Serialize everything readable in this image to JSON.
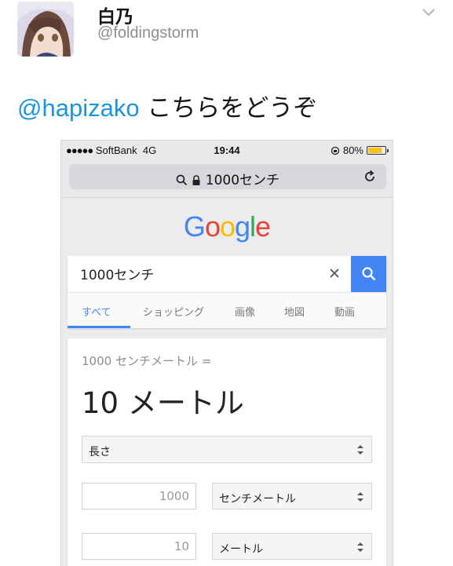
{
  "tweet": {
    "display_name": "白乃",
    "handle": "@foldingstorm",
    "mention": "@hapizako",
    "text": " こちらをどうぞ",
    "more_icon": "chevron-down-icon"
  },
  "phone": {
    "status_bar": {
      "carrier": "SoftBank",
      "network": "4G",
      "time": "19:44",
      "battery": "80%",
      "battery_level": 0.8,
      "battery_color": "#f5c518"
    },
    "url_bar": {
      "text": "1000センチ",
      "icons": [
        "search-icon",
        "lock-icon",
        "reload-icon"
      ]
    },
    "google": {
      "logo_letters": [
        {
          "char": "G",
          "color": "#4285f4"
        },
        {
          "char": "o",
          "color": "#ea4335"
        },
        {
          "char": "o",
          "color": "#fbbc05"
        },
        {
          "char": "g",
          "color": "#4285f4"
        },
        {
          "char": "l",
          "color": "#34a853"
        },
        {
          "char": "e",
          "color": "#ea4335"
        }
      ],
      "search_value": "1000センチ",
      "accent": "#4285f4",
      "tabs": [
        {
          "label": "すべて",
          "active": true
        },
        {
          "label": "ショッピング",
          "active": false
        },
        {
          "label": "画像",
          "active": false
        },
        {
          "label": "地図",
          "active": false
        },
        {
          "label": "動画",
          "active": false
        }
      ],
      "converter": {
        "label": "1000 センチメートル =",
        "result": "10 メートル",
        "category": "長さ",
        "from_value": "1000",
        "from_unit": "センチメートル",
        "to_value": "10",
        "to_unit": "メートル"
      }
    }
  }
}
